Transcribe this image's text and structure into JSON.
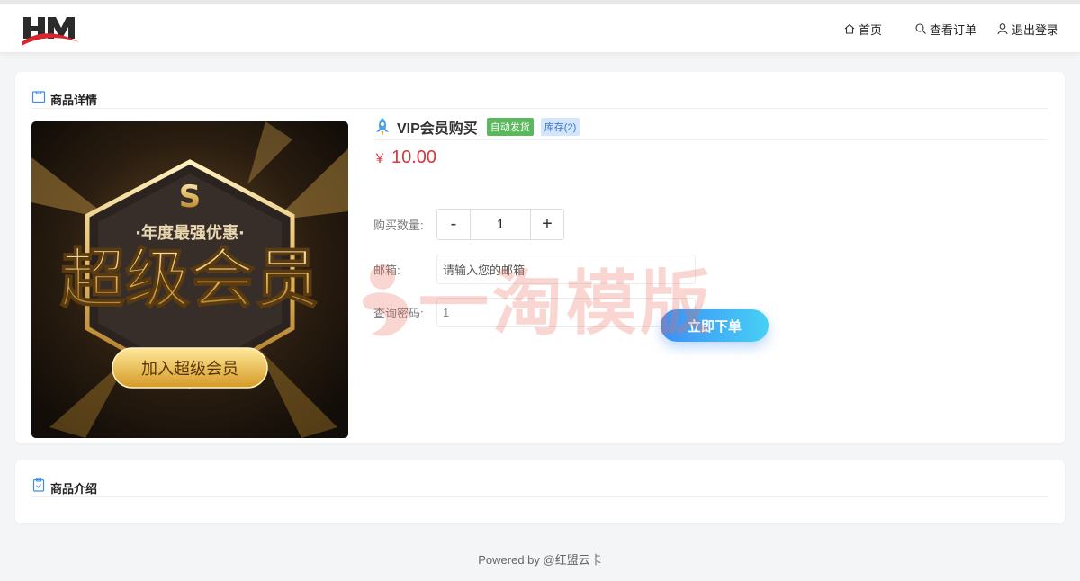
{
  "nav": {
    "links": [
      {
        "label": "首页",
        "icon": "home-icon"
      },
      {
        "label": "查看订单",
        "icon": "search-icon"
      },
      {
        "label": "退出登录",
        "icon": "user-icon"
      }
    ]
  },
  "detail_card": {
    "title": "商品详情"
  },
  "product": {
    "name": "VIP会员购买",
    "badge_auto": "自动发货",
    "badge_stock": "库存(2)",
    "currency": "￥",
    "price": "10.00",
    "image": {
      "emblem": "S",
      "tagline": "·年度最强优惠·",
      "headline": "超级会员",
      "button": "加入超级会员"
    }
  },
  "form": {
    "quantity_label": "购买数量:",
    "quantity_value": "1",
    "minus": "-",
    "plus": "+",
    "email_label": "邮箱:",
    "email_placeholder": "请输入您的邮箱",
    "password_label": "查询密码:",
    "password_value": "1",
    "submit_label": "立即下单"
  },
  "intro_card": {
    "title": "商品介绍"
  },
  "watermark": {
    "text": "一淘模版"
  },
  "footer": {
    "text": "Powered by @红盟云卡"
  },
  "colors": {
    "price": "#d9363e",
    "badge_green": "#5cb85c",
    "badge_blue_bg": "#d3e6fb",
    "button_gradient_start": "#3b8ff5",
    "button_gradient_end": "#48d0f5"
  }
}
